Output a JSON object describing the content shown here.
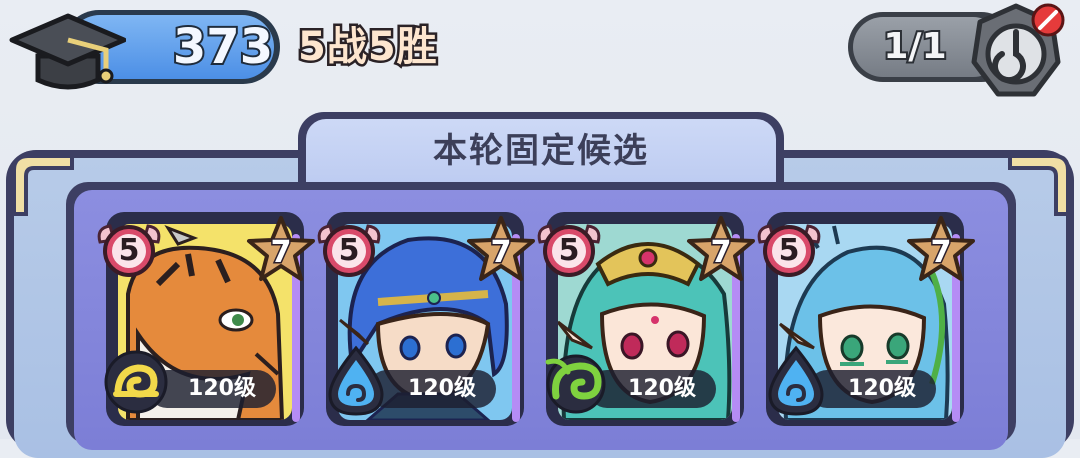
{
  "header": {
    "score": "373",
    "record": "5战5胜",
    "attempts": "1/1",
    "cap_icon": "graduation-cap-icon",
    "timer_icon": "disabled-timer-icon"
  },
  "panel": {
    "title": "本轮固定候选"
  },
  "heroes": [
    {
      "rank": "5",
      "stars": "7",
      "level": "120级",
      "element": "earth",
      "element_icon": "earth-swirl-icon",
      "element_color": "#f2d94a",
      "portrait": "tiger-warrior"
    },
    {
      "rank": "5",
      "stars": "7",
      "level": "120级",
      "element": "water",
      "element_icon": "water-drop-icon",
      "element_color": "#4fb2f2",
      "portrait": "blue-haired-elf"
    },
    {
      "rank": "5",
      "stars": "7",
      "level": "120级",
      "element": "wood",
      "element_icon": "wood-leaf-icon",
      "element_color": "#7fd23f",
      "portrait": "teal-haired-priestess"
    },
    {
      "rank": "5",
      "stars": "7",
      "level": "120级",
      "element": "water",
      "element_icon": "water-drop-icon",
      "element_color": "#4fb2f2",
      "portrait": "light-blue-haired-elf"
    }
  ],
  "colors": {
    "score_pill": "#4c8fe6",
    "panel": "#b7cbe8",
    "inner": "#8c8ee0",
    "frame": "#3d3f63"
  }
}
